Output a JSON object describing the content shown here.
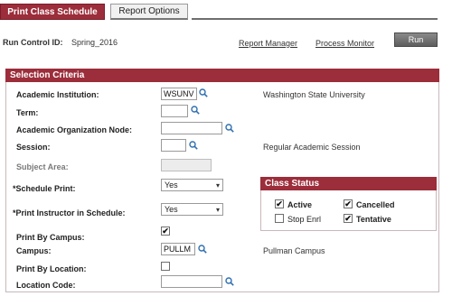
{
  "tabs": {
    "active": "Print Class Schedule",
    "inactive": "Report Options"
  },
  "run_control": {
    "label": "Run Control ID:",
    "value": "Spring_2016",
    "report_manager": "Report Manager",
    "process_monitor": "Process Monitor",
    "run_button": "Run"
  },
  "selection": {
    "title": "Selection Criteria",
    "academic_institution": {
      "label": "Academic Institution:",
      "value": "WSUNV",
      "description": "Washington State University"
    },
    "term": {
      "label": "Term:",
      "value": ""
    },
    "academic_org_node": {
      "label": "Academic Organization Node:",
      "value": ""
    },
    "session": {
      "label": "Session:",
      "value": "",
      "description": "Regular Academic Session"
    },
    "subject_area": {
      "label": "Subject Area:",
      "value": ""
    },
    "schedule_print": {
      "label": "*Schedule Print:",
      "value": "Yes"
    },
    "print_instructor": {
      "label": "*Print Instructor in Schedule:",
      "value": "Yes"
    },
    "print_by_campus": {
      "label": "Print By Campus:",
      "checked": true
    },
    "campus": {
      "label": "Campus:",
      "value": "PULLM",
      "description": "Pullman Campus"
    },
    "print_by_location": {
      "label": "Print By Location:",
      "checked": false
    },
    "location_code": {
      "label": "Location Code:",
      "value": ""
    }
  },
  "class_status": {
    "title": "Class Status",
    "active": {
      "label": "Active",
      "checked": true
    },
    "cancelled": {
      "label": "Cancelled",
      "checked": true
    },
    "stop_enrl": {
      "label": "Stop Enrl",
      "checked": false
    },
    "tentative": {
      "label": "Tentative",
      "checked": true
    }
  },
  "colors": {
    "accent": "#9c2d3a",
    "tab_line": "#6e6e6e",
    "run_button": "#6b6b6b"
  },
  "icons": {
    "lookup": "magnifier-icon",
    "checkmark": "✔",
    "dropdown": "chevron-down-icon"
  }
}
